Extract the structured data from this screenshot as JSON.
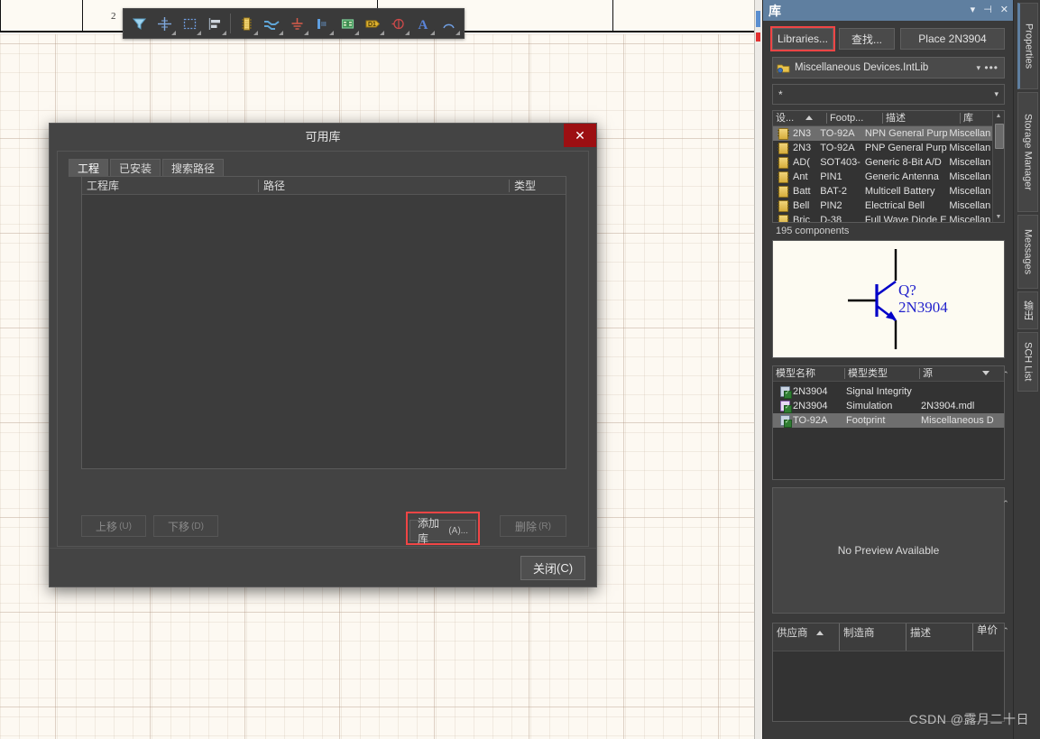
{
  "canvas": {
    "sheet_tick_label": "2"
  },
  "toolbar": {
    "tools": [
      {
        "name": "filter-icon",
        "title": "Filter"
      },
      {
        "name": "crosshair-icon",
        "title": "Place Part Crosshair"
      },
      {
        "name": "selection-rectangle-icon",
        "title": "Area Select"
      },
      {
        "name": "align-left-icon",
        "title": "Align"
      },
      {
        "name": "ic-component-icon",
        "title": "Place Part"
      },
      {
        "name": "wire-icon",
        "title": "Place Wire"
      },
      {
        "name": "ground-icon",
        "title": "Place GND Power Port"
      },
      {
        "name": "net-label-icon",
        "title": "Place Net Label"
      },
      {
        "name": "sheet-symbol-icon",
        "title": "Place Sheet Symbol"
      },
      {
        "name": "designator-icon",
        "title": "Place Port"
      },
      {
        "name": "no-erc-icon",
        "title": "Place No ERC"
      },
      {
        "name": "text-icon",
        "title": "Place Text String"
      },
      {
        "name": "arc-icon",
        "title": "Place Arc"
      }
    ]
  },
  "dialog": {
    "title": "可用库",
    "close_label": "✕",
    "tabs": [
      {
        "label": "工程",
        "active": true
      },
      {
        "label": "已安装",
        "active": false
      },
      {
        "label": "搜索路径",
        "active": false
      }
    ],
    "columns": [
      "工程库",
      "路径",
      "类型"
    ],
    "rows": [],
    "buttons": {
      "move_up": "上移",
      "move_up_mnemonic": "(U)",
      "move_down": "下移",
      "move_down_mnemonic": "(D)",
      "add_library": "添加库",
      "add_library_mnemonic": "(A)...",
      "remove": "删除",
      "remove_mnemonic": "(R)",
      "close": "关闭",
      "close_mnemonic": "(C)"
    },
    "highlight_color": "#f04545"
  },
  "panel": {
    "title": "库",
    "title_bar_color": "#5f7fa0",
    "header_icons": [
      {
        "name": "chevron-down-icon",
        "glyph": "▾"
      },
      {
        "name": "pin-icon",
        "glyph": "⊣"
      },
      {
        "name": "close-icon",
        "glyph": "✕"
      }
    ],
    "buttons": {
      "libraries": "Libraries...",
      "search": "查找...",
      "place": "Place 2N3904"
    },
    "library_select": {
      "value": "Miscellaneous Devices.IntLib",
      "dropdown_glyph": "▾",
      "more_glyph": "•••",
      "icon": "library-folder-icon"
    },
    "filter": {
      "value": "*",
      "dropdown_glyph": "▾"
    },
    "components_grid": {
      "columns": [
        "设...",
        "Footp...",
        "描述",
        "库"
      ],
      "sorted_column": 0,
      "sort_direction": "asc",
      "rows": [
        {
          "designator": "2N3",
          "footprint": "TO-92A",
          "description": "NPN General Purp",
          "library": "Miscellan",
          "selected": true
        },
        {
          "designator": "2N3",
          "footprint": "TO-92A",
          "description": "PNP General Purp",
          "library": "Miscellan",
          "selected": false
        },
        {
          "designator": "AD(",
          "footprint": "SOT403-",
          "description": "Generic 8-Bit A/D",
          "library": "Miscellan",
          "selected": false
        },
        {
          "designator": "Ant",
          "footprint": "PIN1",
          "description": "Generic Antenna",
          "library": "Miscellan",
          "selected": false
        },
        {
          "designator": "Batt",
          "footprint": "BAT-2",
          "description": "Multicell Battery",
          "library": "Miscellan",
          "selected": false
        },
        {
          "designator": "Bell",
          "footprint": "PIN2",
          "description": "Electrical Bell",
          "library": "Miscellan",
          "selected": false
        },
        {
          "designator": "Bric",
          "footprint": "D-38",
          "description": "Full Wave Diode E",
          "library": "Miscellan",
          "selected": false
        }
      ],
      "count_label": "195 components"
    },
    "symbol_preview": {
      "designator": "Q?",
      "part_name": "2N3904",
      "symbol": "npn-transistor-symbol",
      "line_color": "#0000c8",
      "background": "#fdfbf2"
    },
    "models_grid": {
      "columns": [
        "模型名称",
        "模型类型",
        "源"
      ],
      "sorted_column": 2,
      "rows": [
        {
          "name": "2N3904",
          "type": "Signal Integrity",
          "source": "",
          "selected": false,
          "icon": "signal-model-icon"
        },
        {
          "name": "2N3904",
          "type": "Simulation",
          "source": "2N3904.mdl",
          "selected": false,
          "icon": "simulation-model-icon"
        },
        {
          "name": "TO-92A",
          "type": "Footprint",
          "source": "Miscellaneous D",
          "selected": true,
          "icon": "footprint-model-icon"
        }
      ]
    },
    "model_preview": {
      "message": "No Preview Available"
    },
    "supplier_grid": {
      "columns": [
        "供应商",
        "制造商",
        "描述",
        "单价"
      ],
      "sorted_column": 0,
      "rows": []
    },
    "collapse_glyph": "⌃"
  },
  "dock": {
    "tabs": [
      {
        "label": "Properties",
        "active": true
      },
      {
        "label": "Storage Manager",
        "active": false
      },
      {
        "label": "Messages",
        "active": false
      },
      {
        "label": "输出",
        "active": false
      },
      {
        "label": "SCH List",
        "active": false
      }
    ]
  },
  "watermark": "CSDN @露月二十日"
}
